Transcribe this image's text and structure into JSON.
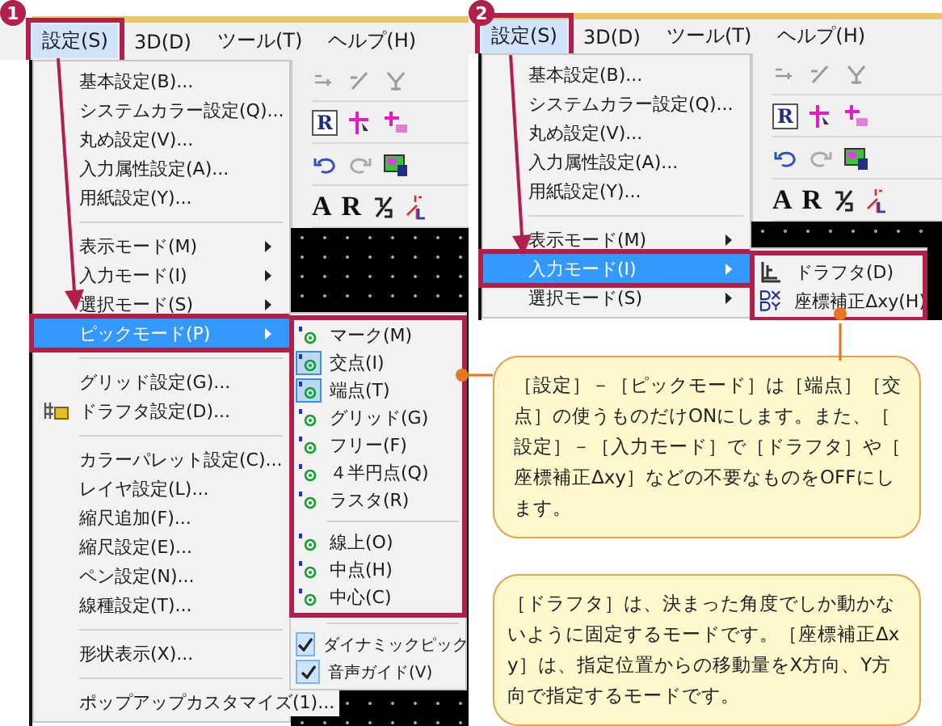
{
  "panels": [
    {
      "step": "1",
      "menubar": [
        {
          "label": "設定(S)",
          "selected": true
        },
        {
          "label": "3D(D)",
          "selected": false
        },
        {
          "label": "ツール(T)",
          "selected": false
        },
        {
          "label": "ヘルプ(H)",
          "selected": false
        }
      ],
      "menu": [
        {
          "kind": "item",
          "label": "基本設定(B)...",
          "selected": false
        },
        {
          "kind": "item",
          "label": "システムカラー設定(Q)...",
          "selected": false
        },
        {
          "kind": "item",
          "label": "丸め設定(V)...",
          "selected": false
        },
        {
          "kind": "item",
          "label": "入力属性設定(A)...",
          "selected": false
        },
        {
          "kind": "item",
          "label": "用紙設定(Y)...",
          "selected": false
        },
        {
          "kind": "separator"
        },
        {
          "kind": "submenu",
          "label": "表示モード(M)",
          "selected": false
        },
        {
          "kind": "submenu",
          "label": "入力モード(I)",
          "selected": false
        },
        {
          "kind": "submenu",
          "label": "選択モード(S)",
          "selected": false
        },
        {
          "kind": "submenu",
          "label": "ピックモード(P)",
          "selected": true
        },
        {
          "kind": "separator"
        },
        {
          "kind": "item",
          "label": "グリッド設定(G)...",
          "selected": false
        },
        {
          "kind": "icon_item",
          "label": "ドラフタ設定(D)...",
          "selected": false
        },
        {
          "kind": "separator"
        },
        {
          "kind": "item",
          "label": "カラーパレット設定(C)...",
          "selected": false
        },
        {
          "kind": "item",
          "label": "レイヤ設定(L)...",
          "selected": false
        },
        {
          "kind": "item",
          "label": "縮尺追加(F)...",
          "selected": false
        },
        {
          "kind": "item",
          "label": "縮尺設定(E)...",
          "selected": false
        },
        {
          "kind": "item",
          "label": "ペン設定(N)...",
          "selected": false
        },
        {
          "kind": "item",
          "label": "線種設定(T)...",
          "selected": false
        },
        {
          "kind": "separator"
        },
        {
          "kind": "item",
          "label": "形状表示(X)...",
          "selected": false
        },
        {
          "kind": "separator"
        },
        {
          "kind": "item",
          "label": "ポップアップカスタマイズ(1)...",
          "selected": false
        }
      ],
      "submenu": {
        "groups": [
          {
            "highlighted": true,
            "items": [
              {
                "kind": "pick",
                "label": "マーク(M)",
                "checked": false
              },
              {
                "kind": "pick",
                "label": "交点(I)",
                "checked": true
              },
              {
                "kind": "pick",
                "label": "端点(T)",
                "checked": true
              },
              {
                "kind": "pick",
                "label": "グリッド(G)",
                "checked": false
              },
              {
                "kind": "pick",
                "label": "フリー(F)",
                "checked": false
              },
              {
                "kind": "pick",
                "label": "４半円点(Q)",
                "checked": false
              },
              {
                "kind": "pick",
                "label": "ラスタ(R)",
                "checked": false
              },
              {
                "kind": "separator"
              },
              {
                "kind": "pick",
                "label": "線上(O)",
                "checked": false
              },
              {
                "kind": "pick",
                "label": "中点(H)",
                "checked": false
              },
              {
                "kind": "pick",
                "label": "中心(C)",
                "checked": false
              }
            ]
          },
          {
            "highlighted": false,
            "items": [
              {
                "kind": "separator"
              },
              {
                "kind": "check",
                "label": "ダイナミックピック",
                "checked": true
              },
              {
                "kind": "check",
                "label": "音声ガイド(V)",
                "checked": true
              }
            ]
          }
        ]
      },
      "toolbar": {
        "glyphs": [
          "R",
          "A",
          "R"
        ]
      }
    },
    {
      "step": "2",
      "menubar": [
        {
          "label": "設定(S)",
          "selected": true
        },
        {
          "label": "3D(D)",
          "selected": false
        },
        {
          "label": "ツール(T)",
          "selected": false
        },
        {
          "label": "ヘルプ(H)",
          "selected": false
        }
      ],
      "menu": [
        {
          "kind": "item",
          "label": "基本設定(B)...",
          "selected": false
        },
        {
          "kind": "item",
          "label": "システムカラー設定(Q)...",
          "selected": false
        },
        {
          "kind": "item",
          "label": "丸め設定(V)...",
          "selected": false
        },
        {
          "kind": "item",
          "label": "入力属性設定(A)...",
          "selected": false
        },
        {
          "kind": "item",
          "label": "用紙設定(Y)...",
          "selected": false
        },
        {
          "kind": "separator"
        },
        {
          "kind": "submenu",
          "label": "表示モード(M)",
          "selected": false
        },
        {
          "kind": "submenu",
          "label": "入力モード(I)",
          "selected": true
        },
        {
          "kind": "submenu",
          "label": "選択モード(S)",
          "selected": false
        }
      ],
      "submenu": {
        "groups": [
          {
            "highlighted": true,
            "items": [
              {
                "kind": "drafter",
                "label": "ドラフタ(D)"
              },
              {
                "kind": "delta",
                "label": "座標補正Δxy(H)"
              }
            ]
          }
        ]
      },
      "toolbar": {
        "glyphs": [
          "R",
          "A",
          "R"
        ]
      }
    }
  ],
  "callouts": [
    {
      "text": "［設定］－［ピックモード］は［端点］［交点］の使うものだけONにします。また、［設定］－［入力モード］で［ドラフタ］や［座標補正Δxy］などの不要なものをOFFにします。"
    },
    {
      "text": "［ドラフタ］は、決まった角度でしか動かないように固定するモードです。［座標補正Δxy］は、指定位置からの移動量をX方向、Y方向で指定するモードです。"
    }
  ]
}
